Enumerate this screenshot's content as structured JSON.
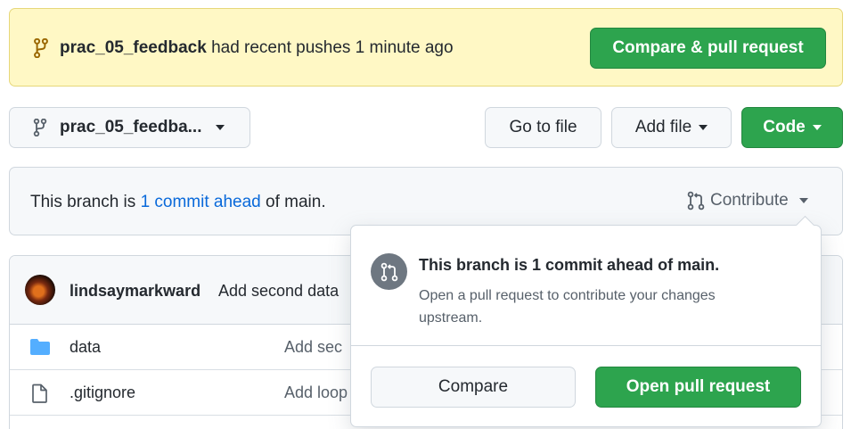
{
  "banner": {
    "branch": "prac_05_feedback",
    "message": "had recent pushes 1 minute ago",
    "compare_button": "Compare & pull request"
  },
  "toolbar": {
    "branch_selector": "prac_05_feedba...",
    "go_to_file": "Go to file",
    "add_file": "Add file",
    "code": "Code"
  },
  "branch_info": {
    "prefix": "This branch is",
    "link": "1 commit ahead",
    "suffix": "of main.",
    "contribute": "Contribute"
  },
  "latest_commit": {
    "author": "lindsaymarkward",
    "message": "Add second data"
  },
  "files": [
    {
      "name": "data",
      "type": "folder",
      "message": "Add sec"
    },
    {
      "name": ".gitignore",
      "type": "file",
      "message": "Add loop"
    }
  ],
  "popover": {
    "title": "This branch is 1 commit ahead of main.",
    "description": "Open a pull request to contribute your changes upstream.",
    "compare": "Compare",
    "open_pr": "Open pull request"
  },
  "colors": {
    "accent_green": "#2da44e",
    "link_blue": "#0969da",
    "banner_yellow": "#fff8c5",
    "folder_blue": "#54aeff"
  }
}
